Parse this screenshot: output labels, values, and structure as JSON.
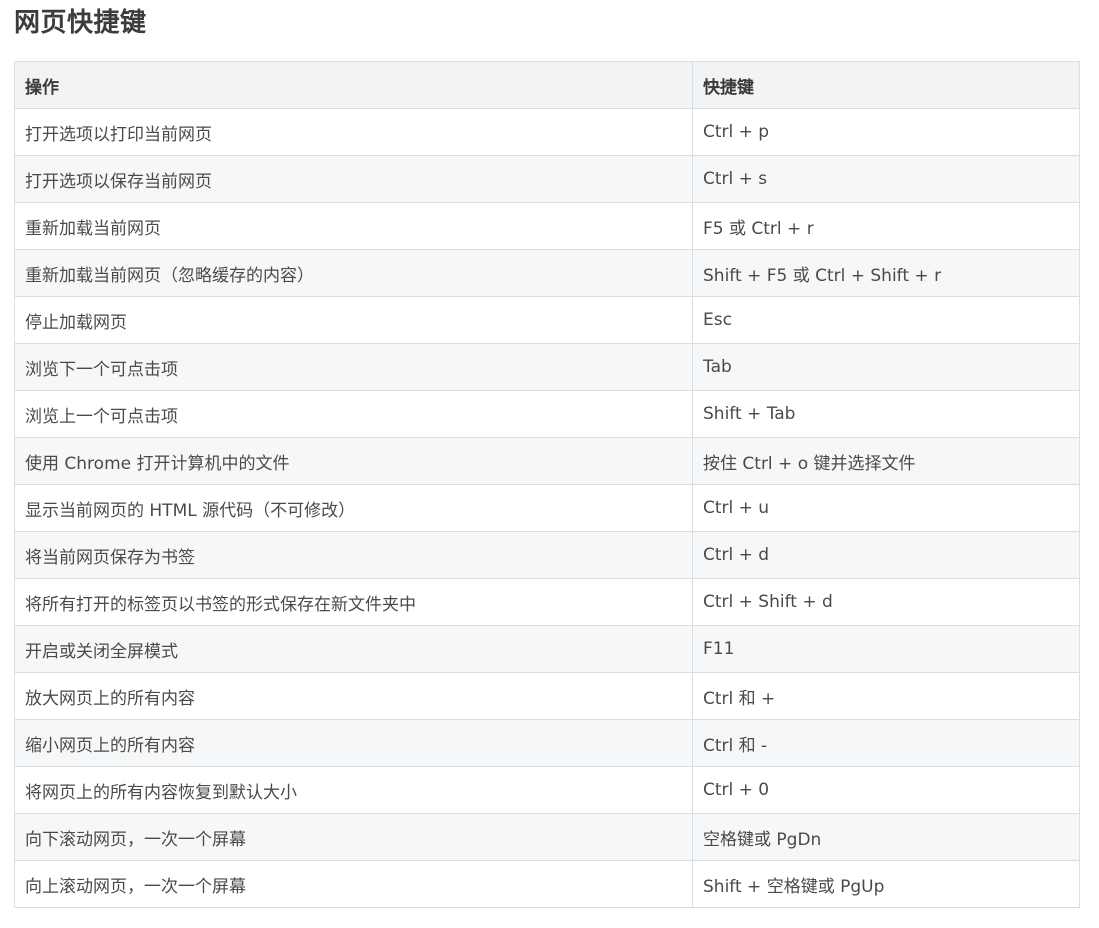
{
  "title": "网页快捷键",
  "table": {
    "headers": [
      "操作",
      "快捷键"
    ],
    "rows": [
      [
        "打开选项以打印当前网页",
        "Ctrl + p"
      ],
      [
        "打开选项以保存当前网页",
        "Ctrl + s"
      ],
      [
        "重新加载当前网页",
        "F5 或 Ctrl + r"
      ],
      [
        "重新加载当前网页（忽略缓存的内容）",
        "Shift + F5 或 Ctrl + Shift + r"
      ],
      [
        "停止加载网页",
        "Esc"
      ],
      [
        "浏览下一个可点击项",
        "Tab"
      ],
      [
        "浏览上一个可点击项",
        "Shift + Tab"
      ],
      [
        "使用 Chrome 打开计算机中的文件",
        "按住 Ctrl + o 键并选择文件"
      ],
      [
        "显示当前网页的 HTML 源代码（不可修改）",
        "Ctrl + u"
      ],
      [
        "将当前网页保存为书签",
        "Ctrl + d"
      ],
      [
        "将所有打开的标签页以书签的形式保存在新文件夹中",
        "Ctrl + Shift + d"
      ],
      [
        "开启或关闭全屏模式",
        "F11"
      ],
      [
        "放大网页上的所有内容",
        "Ctrl 和 +"
      ],
      [
        "缩小网页上的所有内容",
        "Ctrl 和 -"
      ],
      [
        "将网页上的所有内容恢复到默认大小",
        "Ctrl + 0"
      ],
      [
        "向下滚动网页，一次一个屏幕",
        "空格键或 PgDn"
      ],
      [
        "向上滚动网页，一次一个屏幕",
        "Shift + 空格键或 PgUp"
      ]
    ]
  }
}
